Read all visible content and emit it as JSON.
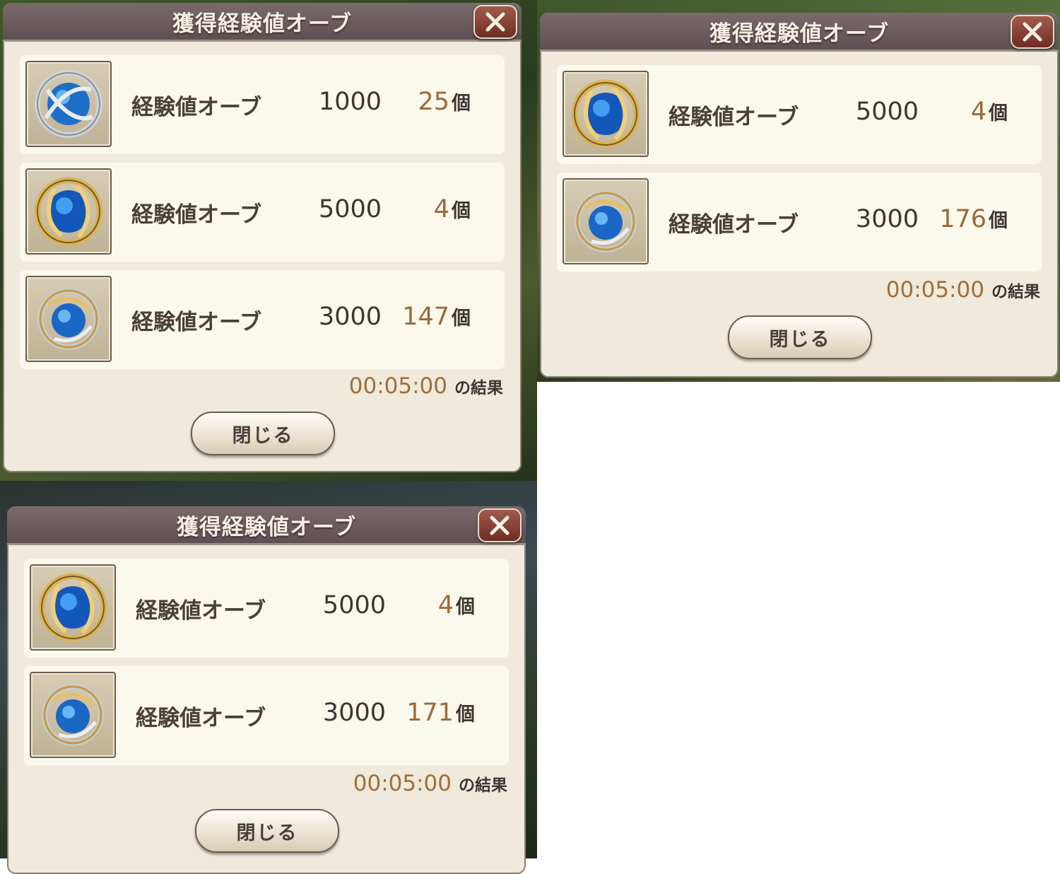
{
  "dialogs": [
    {
      "title": "獲得経験値オーブ",
      "items": [
        {
          "name": "経験値オーブ",
          "value": "1000",
          "count": "25",
          "unit": "個",
          "icon": "silver-orb-icon"
        },
        {
          "name": "経験値オーブ",
          "value": "5000",
          "count": "4",
          "unit": "個",
          "icon": "gold-orb-icon"
        },
        {
          "name": "経験値オーブ",
          "value": "3000",
          "count": "147",
          "unit": "個",
          "icon": "silver-gold-orb-icon"
        }
      ],
      "result_time": "00:05:00",
      "result_label": "の結果",
      "close_label": "閉じる"
    },
    {
      "title": "獲得経験値オーブ",
      "items": [
        {
          "name": "経験値オーブ",
          "value": "5000",
          "count": "4",
          "unit": "個",
          "icon": "gold-orb-icon"
        },
        {
          "name": "経験値オーブ",
          "value": "3000",
          "count": "176",
          "unit": "個",
          "icon": "silver-gold-orb-icon"
        }
      ],
      "result_time": "00:05:00",
      "result_label": "の結果",
      "close_label": "閉じる"
    },
    {
      "title": "獲得経験値オーブ",
      "items": [
        {
          "name": "経験値オーブ",
          "value": "5000",
          "count": "4",
          "unit": "個",
          "icon": "gold-orb-icon"
        },
        {
          "name": "経験値オーブ",
          "value": "3000",
          "count": "171",
          "unit": "個",
          "icon": "silver-gold-orb-icon"
        }
      ],
      "result_time": "00:05:00",
      "result_label": "の結果",
      "close_label": "閉じる"
    }
  ],
  "colors": {
    "panel": "#efeadc",
    "row": "#fbf8ec",
    "titlebar": "#6b5b5e",
    "count": "#9a6a3a",
    "close_x": "#a25a4a"
  }
}
